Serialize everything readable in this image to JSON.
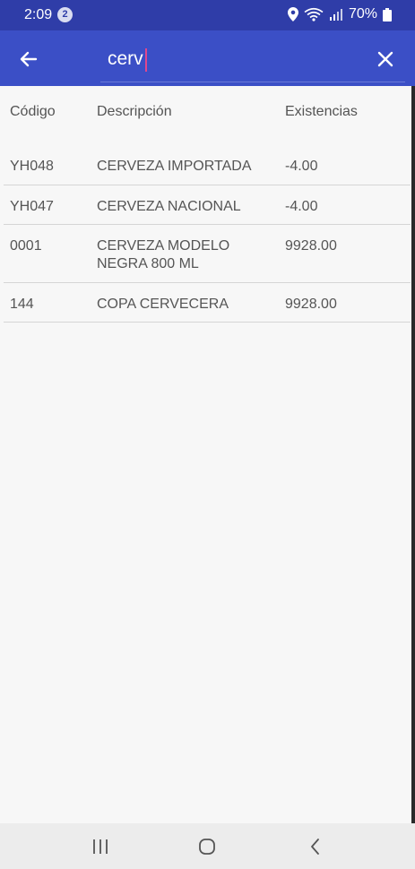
{
  "status_bar": {
    "time": "2:09",
    "notification_count": "2",
    "battery": "70%",
    "icons": [
      "location-icon",
      "wifi-icon",
      "signal-icon",
      "battery-icon"
    ]
  },
  "app_bar": {
    "back_icon": "arrow-left-icon",
    "search_value": "cerv",
    "clear_icon": "close-icon",
    "background": "#3b4fc6",
    "status_background": "#2f3da8",
    "caret_color": "#e0468d"
  },
  "table": {
    "headers": {
      "code": "Código",
      "description": "Descripción",
      "stock": "Existencias"
    },
    "rows": [
      {
        "code": "YH048",
        "description": "CERVEZA IMPORTADA",
        "stock": "-4.00"
      },
      {
        "code": "YH047",
        "description": "CERVEZA NACIONAL",
        "stock": "-4.00"
      },
      {
        "code": "0001",
        "description": "CERVEZA MODELO NEGRA 800 ML",
        "stock": "9928.00"
      },
      {
        "code": "144",
        "description": "COPA CERVECERA",
        "stock": "9928.00"
      }
    ]
  },
  "nav_bar": {
    "icons": [
      "recent-apps-icon",
      "home-icon",
      "back-nav-icon"
    ]
  }
}
